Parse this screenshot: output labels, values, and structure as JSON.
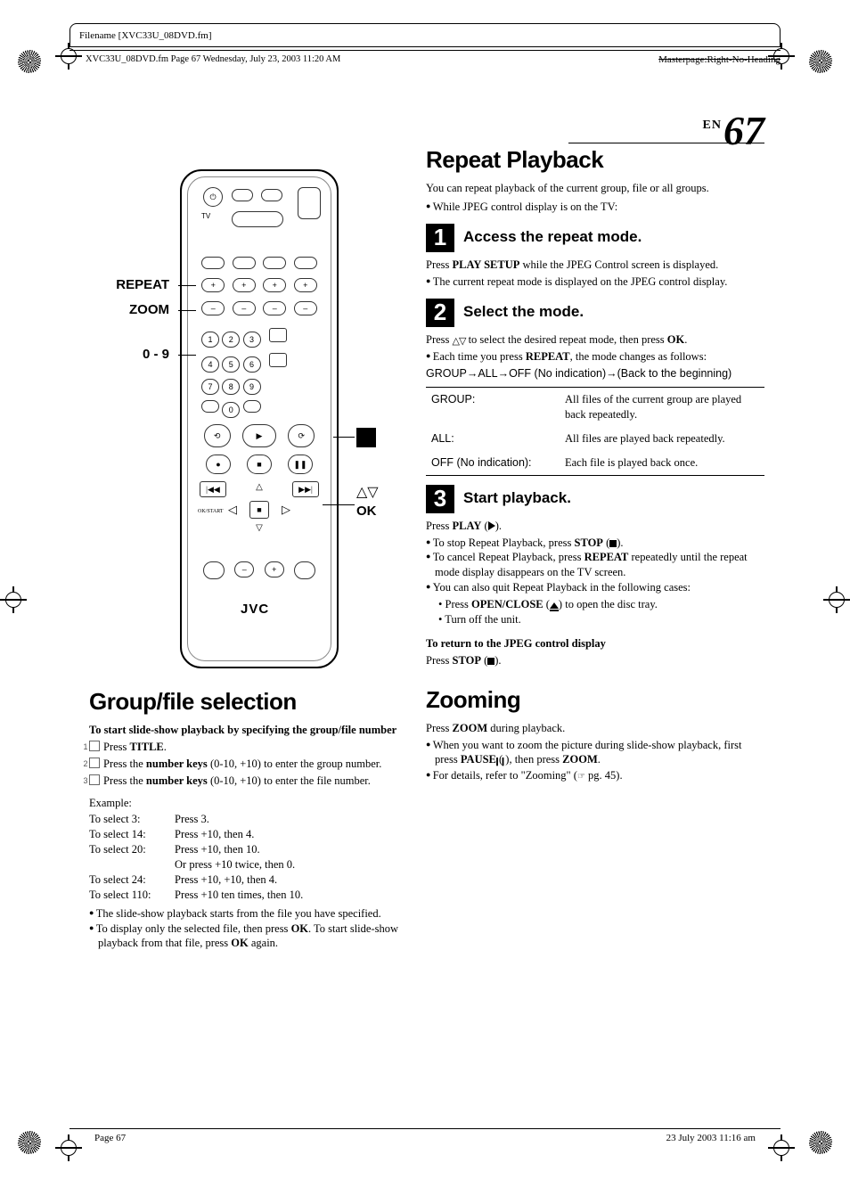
{
  "header": {
    "filename_label_line": "Filename [XVC33U_08DVD.fm]",
    "left_meta": "XVC33U_08DVD.fm  Page 67  Wednesday, July 23, 2003  11:20 AM",
    "right_meta": "Masterpage:Right-No-Heading"
  },
  "page_number": {
    "prefix": "EN",
    "value": "67"
  },
  "remote": {
    "labels": {
      "repeat": "REPEAT",
      "zoom": "ZOOM",
      "digits": "0 - 9",
      "tv": "TV",
      "brand": "JVC",
      "ok": "OK"
    },
    "right_callout_symbols": "△▽"
  },
  "group_file": {
    "title": "Group/file selection",
    "lead_bold": "To start slide-show playback by specifying the group/file number",
    "steps": [
      {
        "n": "1",
        "text_pre": "Press ",
        "bold": "TITLE",
        "text_post": "."
      },
      {
        "n": "2",
        "text_pre": "Press the ",
        "bold": "number keys",
        "text_post": " (0-10, +10) to enter the group number."
      },
      {
        "n": "3",
        "text_pre": "Press the ",
        "bold": "number keys",
        "text_post": " (0-10, +10) to enter the file number."
      }
    ],
    "example_label": "Example:",
    "examples": [
      {
        "k": "To select 3:",
        "v": "Press 3."
      },
      {
        "k": "To select 14:",
        "v": "Press +10, then 4."
      },
      {
        "k": "To select 20:",
        "v": "Press +10, then 10."
      },
      {
        "k": "",
        "v": "Or press +10 twice, then 0."
      },
      {
        "k": "To select 24:",
        "v": "Press +10, +10, then 4."
      },
      {
        "k": "To select 110:",
        "v": "Press +10 ten times, then 10."
      }
    ],
    "bullets": [
      "The slide-show playback starts from the file you have specified.",
      "To display only the selected file, then press OK. To start slide-show playback from that file, press OK again."
    ],
    "bullets_bold_word": "OK"
  },
  "repeat": {
    "title": "Repeat Playback",
    "intro": "You can repeat playback of the current group, file or all groups.",
    "intro_bullet": "While JPEG control display is on the TV:",
    "step1": {
      "h": "Access the repeat mode.",
      "p_pre": "Press ",
      "p_bold": "PLAY SETUP",
      "p_post": " while the JPEG Control screen is displayed.",
      "b1": "The current repeat mode is displayed on the JPEG control display."
    },
    "step2": {
      "h": "Select the mode.",
      "p1_pre": "Press ",
      "p1_post": " to select the desired repeat mode, then press ",
      "ok": "OK",
      "b1_pre": "Each time you press ",
      "b1_bold": "REPEAT",
      "b1_post": ", the mode changes as follows:",
      "seq": "GROUP→ALL→OFF (No indication)→(Back to the beginning)",
      "table": [
        {
          "k": "GROUP:",
          "v": "All files of the current group are played back repeatedly."
        },
        {
          "k": "ALL:",
          "v": "All files are played back repeatedly."
        },
        {
          "k": "OFF (No indication):",
          "v": "Each file is played back once."
        }
      ]
    },
    "step3": {
      "h": "Start playback.",
      "p_pre": "Press ",
      "p_bold": "PLAY",
      "b1_pre": "To stop Repeat Playback, press ",
      "b1_bold": "STOP",
      "b2_pre": "To cancel Repeat Playback, press ",
      "b2_bold": "REPEAT",
      "b2_post": " repeatedly until the repeat mode display disappears on the TV screen.",
      "b3": "You can also quit Repeat Playback in the following cases:",
      "sub1_pre": "Press ",
      "sub1_bold": "OPEN/CLOSE",
      "sub1_post": " to open the disc tray.",
      "sub2": "Turn off the unit.",
      "ret_h": "To return to the JPEG control display",
      "ret_p_pre": "Press ",
      "ret_p_bold": "STOP"
    }
  },
  "zoom": {
    "title": "Zooming",
    "p_pre": "Press ",
    "p_bold": "ZOOM",
    "p_post": " during playback.",
    "b1_pre": "When you want to zoom the picture during slide-show playback, first press ",
    "b1_bold1": "PAUSE",
    "b1_mid": ", then press ",
    "b1_bold2": "ZOOM",
    "b2_pre": "For details, refer to \"Zooming\" (",
    "b2_post": " pg. 45)."
  },
  "footer": {
    "left": "Page 67",
    "right": "23 July 2003 11:16 am"
  }
}
